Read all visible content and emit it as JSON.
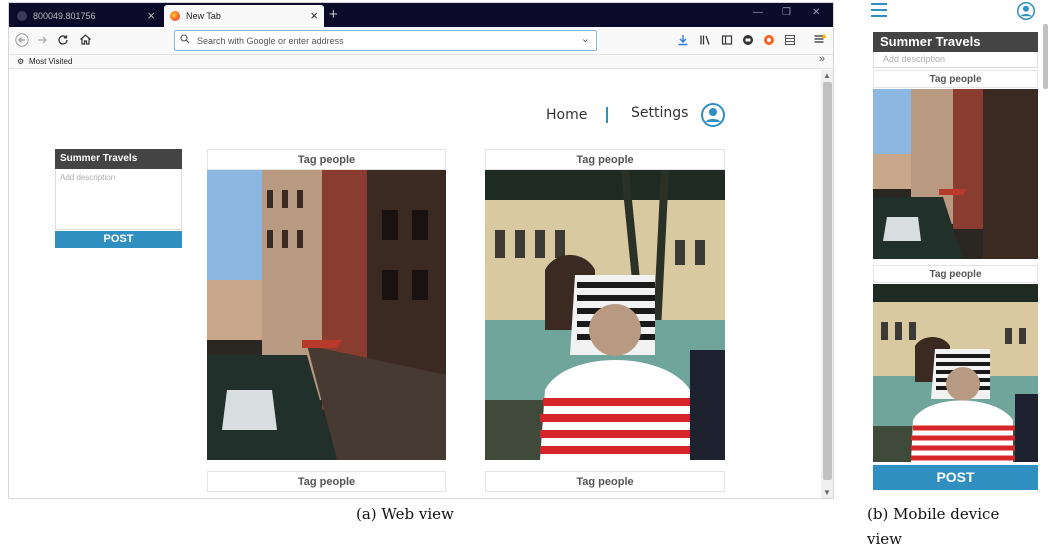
{
  "web": {
    "browser": {
      "tabs": [
        {
          "label": "800049.801756"
        },
        {
          "label": "New Tab"
        }
      ],
      "close_glyph": "×",
      "new_tab_glyph": "+",
      "window_controls": [
        "—",
        "❐",
        "✕"
      ],
      "nav_icons": [
        "back-icon",
        "forward-icon",
        "reload-icon",
        "home-icon"
      ],
      "address_placeholder": "Search with Google or enter address",
      "toolbar_icons": [
        "download-icon",
        "library-icon",
        "sidebar-icon",
        "account-icon",
        "extension-icon",
        "menu-icon"
      ],
      "bookmark_label": "Most Visited",
      "bookmark_more": "»"
    },
    "site": {
      "nav_home": "Home",
      "nav_settings": "Settings",
      "accent": "#2f8fc1"
    },
    "composer": {
      "album_title": "Summer Travels",
      "description_placeholder": "Add description",
      "post_label": "POST"
    },
    "cards": [
      {
        "tag_label": "Tag people",
        "bottom_tag_label": "Tag people",
        "photo": "venice-canal-street"
      },
      {
        "tag_label": "Tag people",
        "bottom_tag_label": "Tag people",
        "photo": "gondolier-and-passenger"
      }
    ]
  },
  "mobile": {
    "album_title": "Summer Travels",
    "description_placeholder": "Add description",
    "tag_labels": [
      "Tag people",
      "Tag people"
    ],
    "post_label": "POST"
  },
  "captions": {
    "web": "(a) Web view",
    "mobile_line1": "(b) Mobile device",
    "mobile_line2": "view"
  }
}
